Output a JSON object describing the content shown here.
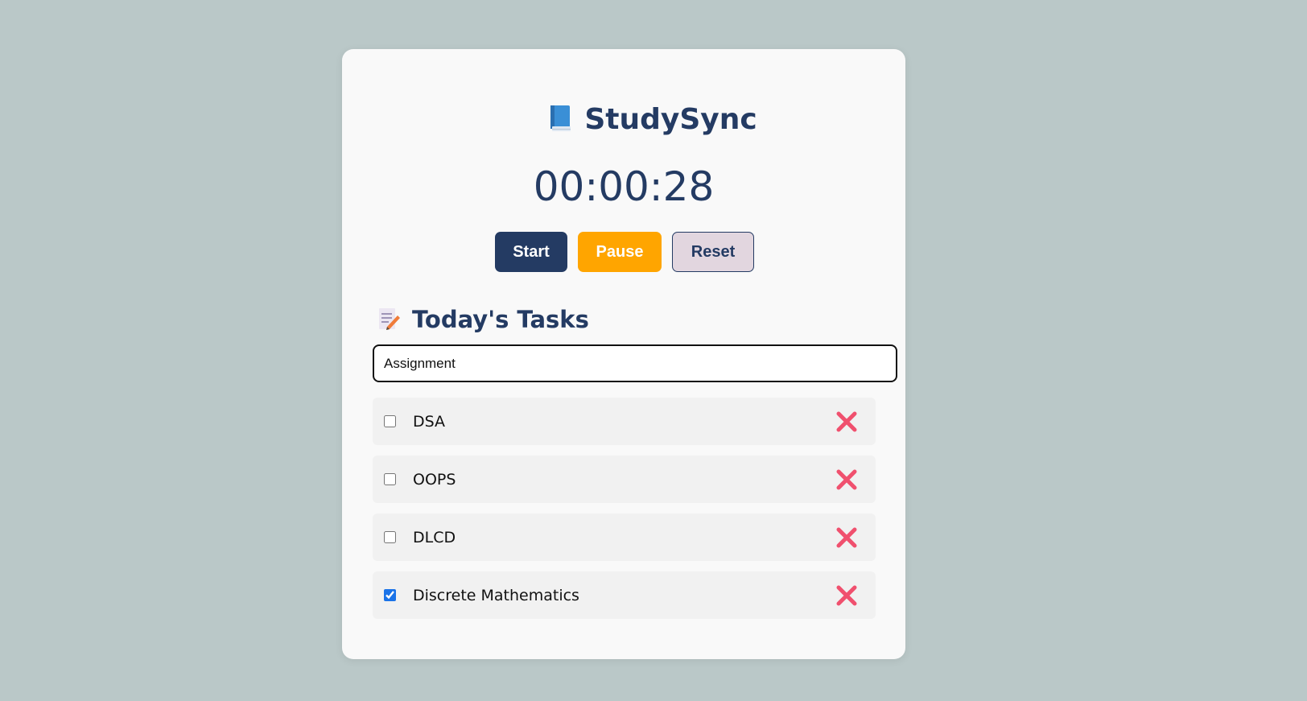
{
  "app": {
    "title": "StudySync",
    "title_icon": "blue-book-icon"
  },
  "timer": {
    "display": "00:00:28"
  },
  "controls": {
    "start_label": "Start",
    "pause_label": "Pause",
    "reset_label": "Reset"
  },
  "tasks": {
    "heading": "Today's Tasks",
    "heading_icon": "memo-icon",
    "input_value": "Assignment",
    "items": [
      {
        "label": "DSA",
        "checked": false
      },
      {
        "label": "OOPS",
        "checked": false
      },
      {
        "label": "DLCD",
        "checked": false
      },
      {
        "label": "Discrete Mathematics",
        "checked": true
      }
    ],
    "delete_icon": "cross-mark-icon"
  },
  "colors": {
    "background": "#bac8c8",
    "card": "#f9f9f9",
    "primary": "#243b63",
    "accent": "#ffa500",
    "reset_bg": "#e2d6df",
    "delete": "#f0506e",
    "task_bg": "#f1f1f1"
  }
}
